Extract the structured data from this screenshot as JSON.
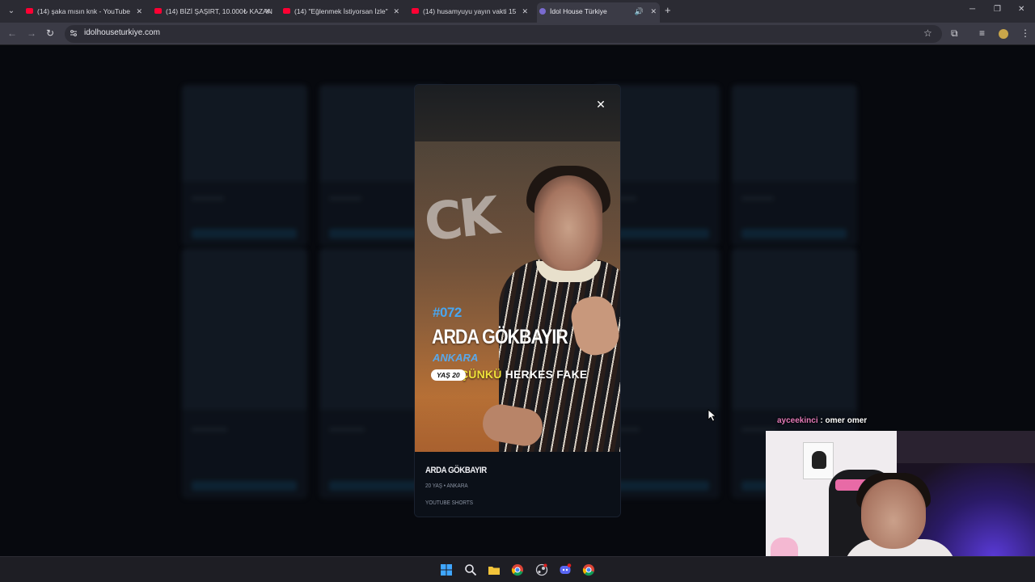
{
  "browser": {
    "tabs": [
      {
        "title": "(14) şaka mısın knk - YouTube",
        "active": false
      },
      {
        "title": "(14) BİZİ ŞAŞIRT, 10.000₺ KAZAN",
        "active": false
      },
      {
        "title": "(14) \"Eğlenmek İstiyorsan İzle\"",
        "active": false
      },
      {
        "title": "(14) husamyuyu yayın vakti 15",
        "active": false
      },
      {
        "title": "İdol House Türkiye",
        "active": true
      }
    ],
    "url": "idolhouseturkiye.com"
  },
  "modal": {
    "video_overlay": {
      "number": "#072",
      "name": "ARDA GÖKBAYIR",
      "city": "ANKARA",
      "age_badge": "YAŞ 20",
      "subtitle_highlight": "ÇÜNKÜ",
      "subtitle_rest": "HERKES FAKE"
    },
    "info": {
      "name": "ARDA GÖKBAYIR",
      "meta": "20 YAŞ • ANKARA",
      "source": "YOUTUBE SHORTS"
    }
  },
  "stream": {
    "chat_user": "ayceekinci",
    "chat_message": " : omer omer"
  },
  "colors": {
    "accent_blue": "#48a6f0",
    "highlight_yellow": "#f0e23a",
    "chat_user_pink": "#e37ab8",
    "youtube_red": "#ff0033"
  },
  "icons": {
    "tab_list": "chevron-down-icon",
    "close": "close-icon",
    "new_tab": "plus-icon",
    "back": "arrow-left-icon",
    "forward": "arrow-right-icon",
    "reload": "reload-icon",
    "site_info": "tune-icon",
    "bookmark": "star-icon",
    "extensions": "puzzle-icon",
    "media": "media-control-icon",
    "profile": "avatar-icon",
    "menu": "kebab-menu-icon"
  }
}
